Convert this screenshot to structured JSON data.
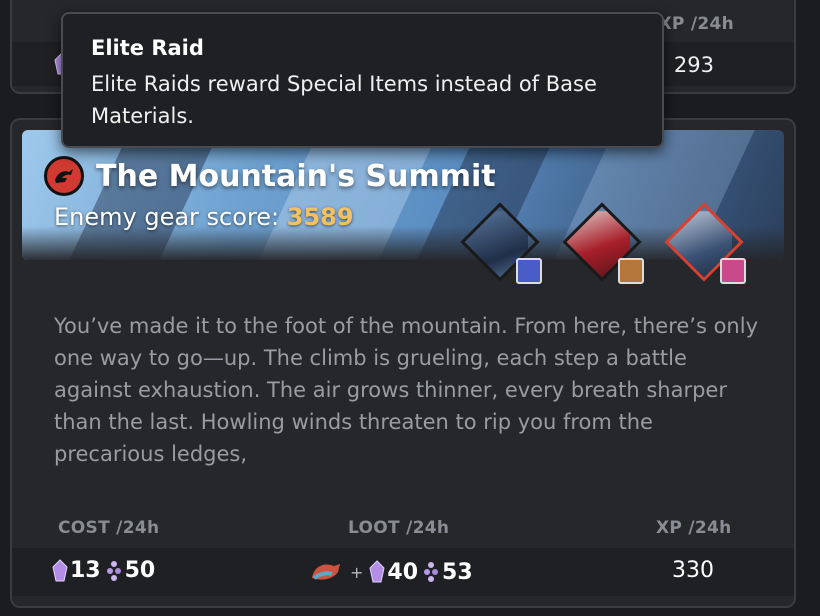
{
  "previous_card": {
    "xp_label": "XP /24h",
    "xp_value": "293"
  },
  "tooltip": {
    "title": "Elite Raid",
    "body": "Elite Raids reward Special Items instead of Base Materials."
  },
  "raid": {
    "title": "The Mountain's Summit",
    "gear_label": "Enemy gear score: ",
    "gear_score": "3589",
    "heroes": [
      {
        "name": "hero-portrait-1",
        "frame": "#1a1a1a",
        "badge": "#4a5cc8"
      },
      {
        "name": "hero-portrait-2",
        "frame": "#1a1a1a",
        "badge": "#b4763a"
      },
      {
        "name": "hero-portrait-3",
        "frame": "#d8402f",
        "badge": "#c94a8a"
      }
    ],
    "description": "You’ve made it to the foot of the mountain. From here, there’s only one way to go—up. The climb is grueling, each step a battle against exhaustion. The air grows thinner, every breath sharper than the last. Howling winds threaten to rip you from the precarious ledges,"
  },
  "stats": {
    "cost_label": "COST /24h",
    "loot_label": "LOOT /24h",
    "xp_label": "XP /24h",
    "cost_gem_a": "13",
    "cost_gem_b": "50",
    "loot_plus": "+",
    "loot_gem_a": "40",
    "loot_gem_b": "53",
    "xp_value": "330"
  },
  "colors": {
    "accent_gold": "#f3c15f",
    "faction_red": "#d03a31",
    "gem_purple": "#b48ee6"
  }
}
